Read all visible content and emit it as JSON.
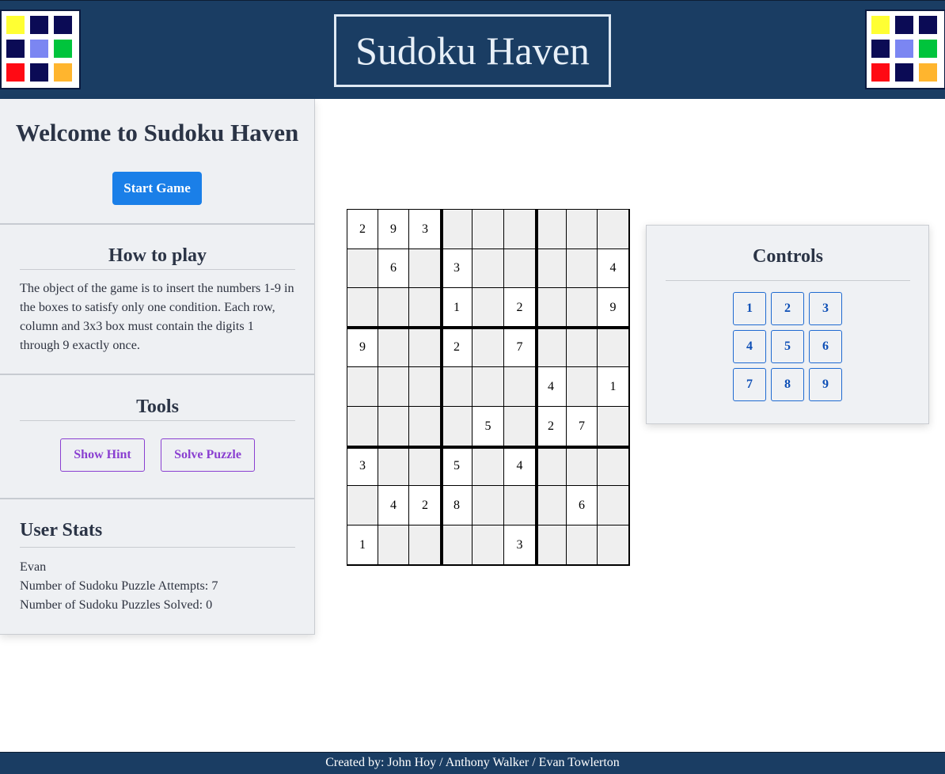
{
  "header": {
    "title": "Sudoku Haven",
    "logo_colors": [
      "#ffff33",
      "#0b0b55",
      "#0b0b55",
      "#0b0b55",
      "#7b86f2",
      "#00c43c",
      "#ff0a14",
      "#0b0b55",
      "#ffb52e"
    ]
  },
  "sidebar": {
    "welcome_title": "Welcome to Sudoku Haven",
    "start_button": "Start Game",
    "howto_title": "How to play",
    "howto_text": "The object of the game is to insert the numbers 1-9 in the boxes to satisfy only one condition. Each row, column and 3x3 box must contain the digits 1 through 9 exactly once.",
    "tools_title": "Tools",
    "hint_button": "Show Hint",
    "solve_button": "Solve Puzzle",
    "stats_title": "User Stats",
    "stats_user": "Evan",
    "stats_attempts": "Number of Sudoku Puzzle Attempts: 7",
    "stats_solved": "Number of Sudoku Puzzles Solved: 0"
  },
  "board": {
    "rows": [
      [
        "2",
        "9",
        "3",
        "",
        "",
        "",
        "",
        "",
        ""
      ],
      [
        "",
        "6",
        "",
        "3",
        "",
        "",
        "",
        "",
        "4"
      ],
      [
        "",
        "",
        "",
        "1",
        "",
        "2",
        "",
        "",
        "9"
      ],
      [
        "9",
        "",
        "",
        "2",
        "",
        "7",
        "",
        "",
        ""
      ],
      [
        "",
        "",
        "",
        "",
        "",
        "",
        "4",
        "",
        "1"
      ],
      [
        "",
        "",
        "",
        "",
        "5",
        "",
        "2",
        "7",
        ""
      ],
      [
        "3",
        "",
        "",
        "5",
        "",
        "4",
        "",
        "",
        ""
      ],
      [
        "",
        "4",
        "2",
        "8",
        "",
        "",
        "",
        "6",
        ""
      ],
      [
        "1",
        "",
        "",
        "",
        "",
        "3",
        "",
        "",
        ""
      ]
    ]
  },
  "controls": {
    "title": "Controls",
    "numbers": [
      "1",
      "2",
      "3",
      "4",
      "5",
      "6",
      "7",
      "8",
      "9"
    ]
  },
  "footer": {
    "credits": "Created by: John Hoy / Anthony Walker / Evan Towlerton"
  }
}
